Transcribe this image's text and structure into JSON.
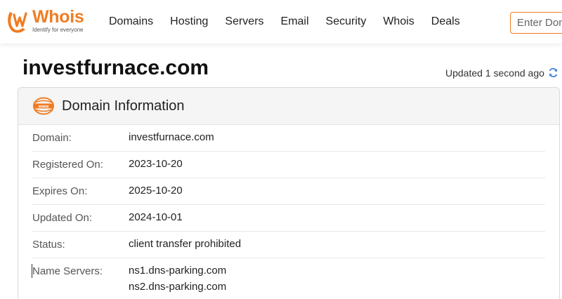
{
  "logo": {
    "word": "Whois",
    "tagline": "Identify for everyone"
  },
  "nav": {
    "items": [
      {
        "label": "Domains"
      },
      {
        "label": "Hosting"
      },
      {
        "label": "Servers"
      },
      {
        "label": "Email"
      },
      {
        "label": "Security"
      },
      {
        "label": "Whois"
      },
      {
        "label": "Deals"
      }
    ],
    "search_placeholder": "Enter Domain"
  },
  "page": {
    "domain": "investfurnace.com",
    "updated_text": "Updated 1 second ago"
  },
  "card": {
    "title": "Domain Information",
    "rows": [
      {
        "label": "Domain:",
        "value": "investfurnace.com"
      },
      {
        "label": "Registered On:",
        "value": "2023-10-20"
      },
      {
        "label": "Expires On:",
        "value": "2025-10-20"
      },
      {
        "label": "Updated On:",
        "value": "2024-10-01"
      },
      {
        "label": "Status:",
        "value": "client transfer prohibited"
      }
    ],
    "name_servers": {
      "label": "Name Servers:",
      "values": [
        "ns1.dns-parking.com",
        "ns2.dns-parking.com"
      ]
    }
  },
  "colors": {
    "brand": "#f07c22",
    "refresh": "#3a7bd5"
  }
}
